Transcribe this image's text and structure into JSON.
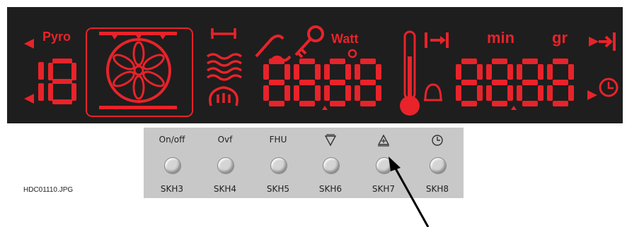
{
  "display": {
    "pyro_label": "Pyro",
    "watt_label": "Watt",
    "min_label": "min",
    "gr_label": "gr",
    "small_digits": "18",
    "main_digits_1": "8888",
    "main_digits_2": "8888",
    "segment_color": "#e8232a",
    "background_color": "#1e1e1e"
  },
  "panel": {
    "buttons": [
      {
        "top": "On/off",
        "bottom": "SKH3"
      },
      {
        "top": "Ovf",
        "bottom": "SKH4"
      },
      {
        "top": "FHU",
        "bottom": "SKH5"
      },
      {
        "top": "",
        "icon": "triangle-down-icon",
        "bottom": "SKH6"
      },
      {
        "top": "",
        "icon": "triangle-up-plus-icon",
        "bottom": "SKH7"
      },
      {
        "top": "",
        "icon": "clock-icon",
        "bottom": "SKH8"
      }
    ]
  },
  "filename": "HDC01110.JPG"
}
